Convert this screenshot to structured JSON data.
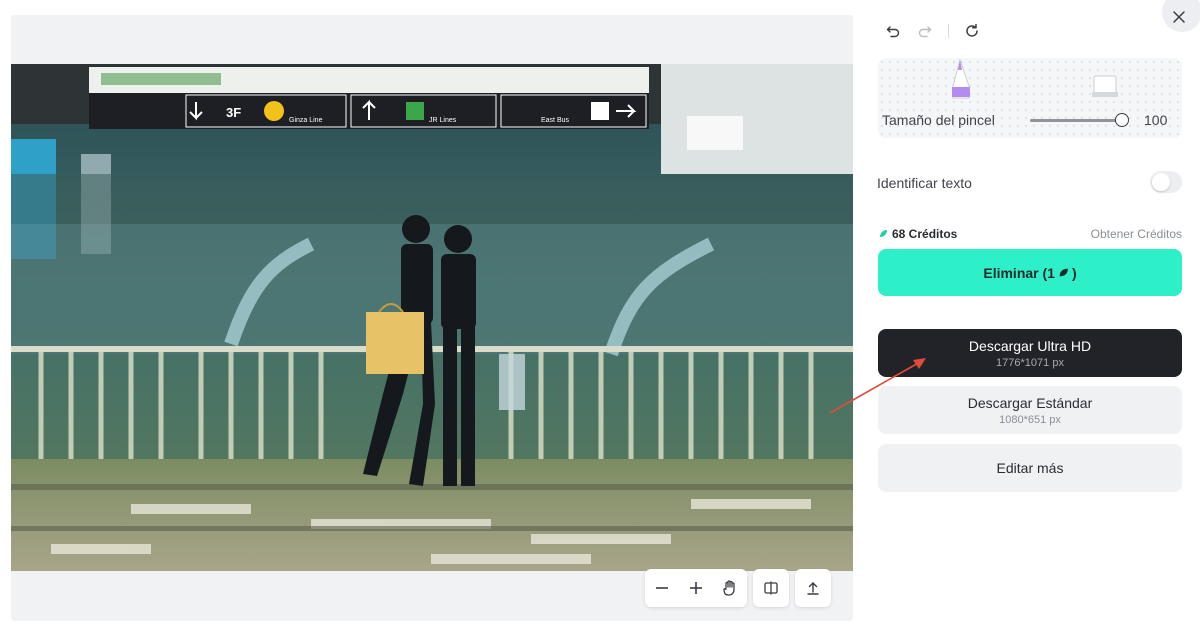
{
  "canvas": {
    "photo": {
      "signs": [
        {
          "text": "3F"
        },
        {
          "text": "Ginza Line"
        },
        {
          "text": "JR Lines"
        },
        {
          "text": "East Bus"
        }
      ]
    },
    "toolbar": {
      "zoom_out_icon": "minus-icon",
      "zoom_in_icon": "plus-icon",
      "pan_icon": "hand-icon",
      "compare_icon": "compare-icon",
      "upload_icon": "upload-icon"
    }
  },
  "panel": {
    "history": {
      "undo_icon": "undo-icon",
      "redo_icon": "redo-icon",
      "reset_icon": "reset-icon"
    },
    "brush": {
      "size_label": "Tamaño del pincel",
      "size_value": "100",
      "size_fraction": 1.0,
      "brush_color": "#b48cf0"
    },
    "identify_text": {
      "label": "Identificar texto",
      "enabled": false
    },
    "credits": {
      "amount": "68 Créditos",
      "get_link": "Obtener Créditos",
      "accent": "#2ef0c8"
    },
    "buttons": {
      "remove_label": "Eliminar (1",
      "remove_suffix": ")",
      "ultra_hd_label": "Descargar Ultra HD",
      "ultra_hd_size": "1776*1071 px",
      "standard_label": "Descargar Estándar",
      "standard_size": "1080*651 px",
      "edit_more_label": "Editar más"
    },
    "close_icon": "close-icon"
  },
  "annotation": {
    "arrow_color": "#e04b3a"
  }
}
